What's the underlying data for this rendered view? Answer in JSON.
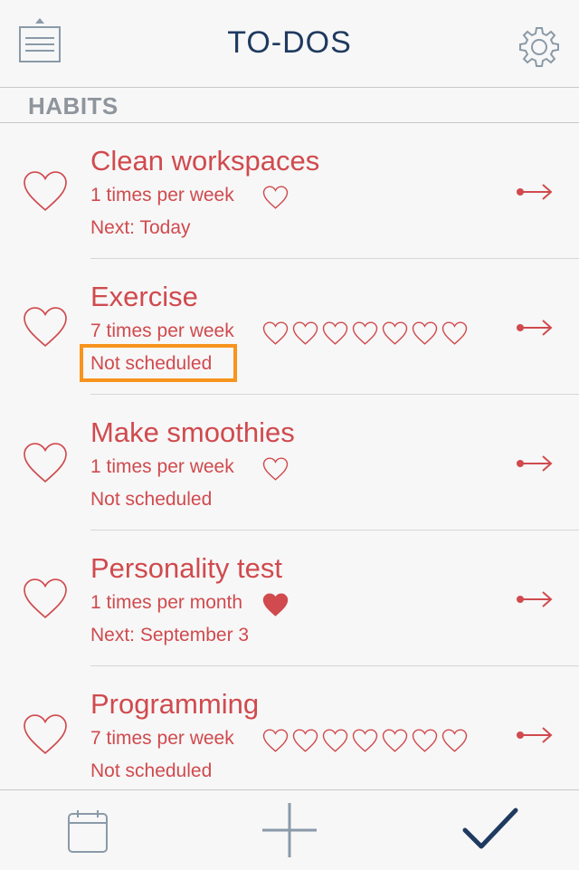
{
  "header": {
    "title": "TO-DOS",
    "menu_icon": "list-menu-icon",
    "settings_icon": "gear-icon"
  },
  "section": {
    "title": "HABITS"
  },
  "habits": [
    {
      "name": "Clean workspaces",
      "frequency": "1 times per week",
      "next": "Next: Today",
      "hearts_total": 1,
      "hearts_filled": 0
    },
    {
      "name": "Exercise",
      "frequency": "7 times per week",
      "next": "Not scheduled",
      "hearts_total": 7,
      "hearts_filled": 0
    },
    {
      "name": "Make smoothies",
      "frequency": "1 times per week",
      "next": "Not scheduled",
      "hearts_total": 1,
      "hearts_filled": 0
    },
    {
      "name": "Personality test",
      "frequency": "1 times per month",
      "next": "Next: September 3",
      "hearts_total": 1,
      "hearts_filled": 1
    },
    {
      "name": "Programming",
      "frequency": "7 times per week",
      "next": "Not scheduled",
      "hearts_total": 7,
      "hearts_filled": 0
    }
  ],
  "tabbar": {
    "calendar_icon": "calendar-icon",
    "add_icon": "plus-icon",
    "done_icon": "checkmark-icon"
  },
  "colors": {
    "accent": "#d04a4e",
    "navy": "#1f3a5f",
    "highlight": "#f7941d",
    "icon_gray": "#8a9aa8"
  }
}
